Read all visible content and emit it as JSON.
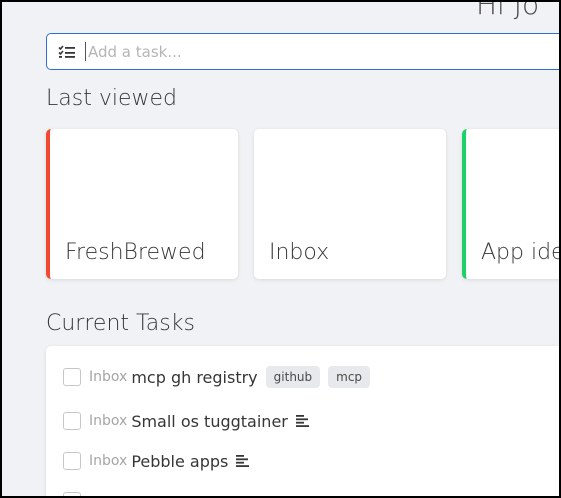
{
  "header": {
    "title_fragment": "Hi Jo"
  },
  "add_task": {
    "placeholder": "Add a task...",
    "icon": "task-list-icon"
  },
  "last_viewed": {
    "heading": "Last viewed",
    "cards": [
      {
        "title": "FreshBrewed",
        "accent": "#f14a30"
      },
      {
        "title": "Inbox",
        "accent": ""
      },
      {
        "title": "App ide",
        "accent": "#1fcf6a"
      }
    ]
  },
  "current_tasks": {
    "heading": "Current Tasks",
    "tasks": [
      {
        "project": "Inbox",
        "text": "mcp gh registry",
        "labels": [
          "github",
          "mcp"
        ]
      },
      {
        "project": "Inbox",
        "text": "Small os tuggtainer",
        "has_description": true
      },
      {
        "project": "Inbox",
        "text": "Pebble apps",
        "has_description": true
      }
    ]
  }
}
